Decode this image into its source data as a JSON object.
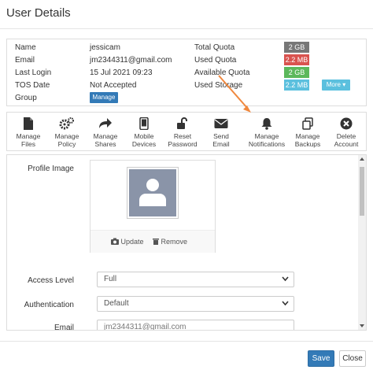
{
  "window": {
    "title": "User Details"
  },
  "info": {
    "labels": [
      "Name",
      "Email",
      "Last Login",
      "TOS Date",
      "Group"
    ],
    "values": [
      "jessicam",
      "jm2344311@gmail.com",
      "15 Jul 2021 09:23",
      "Not Accepted"
    ],
    "group_button": "Manage",
    "quota_labels": [
      "Total Quota",
      "Used Quota",
      "Available Quota",
      "Used Storage"
    ],
    "quota_values": [
      "2 GB",
      "2.2 MB",
      "2 GB",
      "2.2 MB"
    ],
    "quota_colors": [
      "#777777",
      "#d9534f",
      "#5cb85c",
      "#5bc0de"
    ],
    "more_button": "More ▾"
  },
  "toolbar": {
    "items": [
      {
        "l1": "Manage",
        "l2": "Files",
        "icon": "file-icon"
      },
      {
        "l1": "Manage",
        "l2": "Policy",
        "icon": "gears-icon"
      },
      {
        "l1": "Manage",
        "l2": "Shares",
        "icon": "share-arrow-icon"
      },
      {
        "l1": "Mobile",
        "l2": "Devices",
        "icon": "mobile-icon"
      },
      {
        "l1": "Reset",
        "l2": "Password",
        "icon": "unlock-icon"
      },
      {
        "l1": "Send",
        "l2": "Email",
        "icon": "envelope-icon"
      },
      {
        "l1": "Manage",
        "l2": "Notifications",
        "icon": "bell-icon"
      },
      {
        "l1": "Manage",
        "l2": "Backups",
        "icon": "copy-icon"
      },
      {
        "l1": "Delete",
        "l2": "Account",
        "icon": "delete-circle-icon"
      }
    ]
  },
  "form": {
    "profile_image_label": "Profile Image",
    "update_label": "Update",
    "remove_label": "Remove",
    "access_level_label": "Access Level",
    "access_level_value": "Full",
    "authentication_label": "Authentication",
    "authentication_value": "Default",
    "email_label": "Email",
    "email_value": "jm2344311@gmail.com"
  },
  "footer": {
    "save_label": "Save",
    "close_label": "Close"
  },
  "colors": {
    "primary": "#337ab7",
    "annotation": "#f0883e"
  }
}
